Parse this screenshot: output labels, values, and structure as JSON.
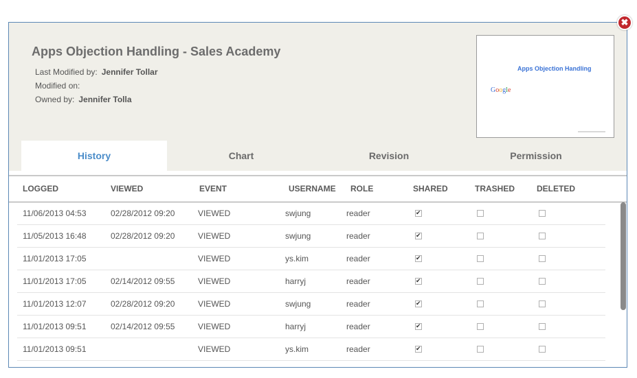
{
  "document": {
    "title": "Apps Objection Handling - Sales Academy",
    "last_modified_label": "Last Modified by:",
    "last_modified_value": "Jennifer Tollar",
    "modified_on_label": "Modified on:",
    "modified_on_value": "",
    "owned_by_label": "Owned by:",
    "owned_by_value": "Jennifer Tolla"
  },
  "thumbnail": {
    "title": "Apps Objection Handling",
    "logo_letters": [
      "G",
      "o",
      "o",
      "g",
      "l",
      "e"
    ]
  },
  "tabs": [
    {
      "label": "History",
      "active": true
    },
    {
      "label": "Chart",
      "active": false
    },
    {
      "label": "Revision",
      "active": false
    },
    {
      "label": "Permission",
      "active": false
    }
  ],
  "table": {
    "columns": [
      "LOGGED",
      "VIEWED",
      "EVENT",
      "USERNAME",
      "ROLE",
      "SHARED",
      "TRASHED",
      "DELETED"
    ],
    "rows": [
      {
        "logged": "11/06/2013 04:53",
        "viewed": "02/28/2012 09:20",
        "event": "VIEWED",
        "username": "swjung",
        "role": "reader",
        "shared": true,
        "trashed": false,
        "deleted": false
      },
      {
        "logged": "11/05/2013 16:48",
        "viewed": "02/28/2012 09:20",
        "event": "VIEWED",
        "username": "swjung",
        "role": "reader",
        "shared": true,
        "trashed": false,
        "deleted": false
      },
      {
        "logged": "11/01/2013 17:05",
        "viewed": "",
        "event": "VIEWED",
        "username": "ys.kim",
        "role": "reader",
        "shared": true,
        "trashed": false,
        "deleted": false
      },
      {
        "logged": "11/01/2013 17:05",
        "viewed": "02/14/2012 09:55",
        "event": "VIEWED",
        "username": "harryj",
        "role": "reader",
        "shared": true,
        "trashed": false,
        "deleted": false
      },
      {
        "logged": "11/01/2013 12:07",
        "viewed": "02/28/2012 09:20",
        "event": "VIEWED",
        "username": "swjung",
        "role": "reader",
        "shared": true,
        "trashed": false,
        "deleted": false
      },
      {
        "logged": "11/01/2013 09:51",
        "viewed": "02/14/2012 09:55",
        "event": "VIEWED",
        "username": "harryj",
        "role": "reader",
        "shared": true,
        "trashed": false,
        "deleted": false
      },
      {
        "logged": "11/01/2013 09:51",
        "viewed": "",
        "event": "VIEWED",
        "username": "ys.kim",
        "role": "reader",
        "shared": true,
        "trashed": false,
        "deleted": false
      }
    ]
  },
  "close_icon": "close-icon",
  "colors": {
    "accent": "#4a8cc9",
    "close": "#c1272d",
    "panel": "#f0efe9"
  }
}
